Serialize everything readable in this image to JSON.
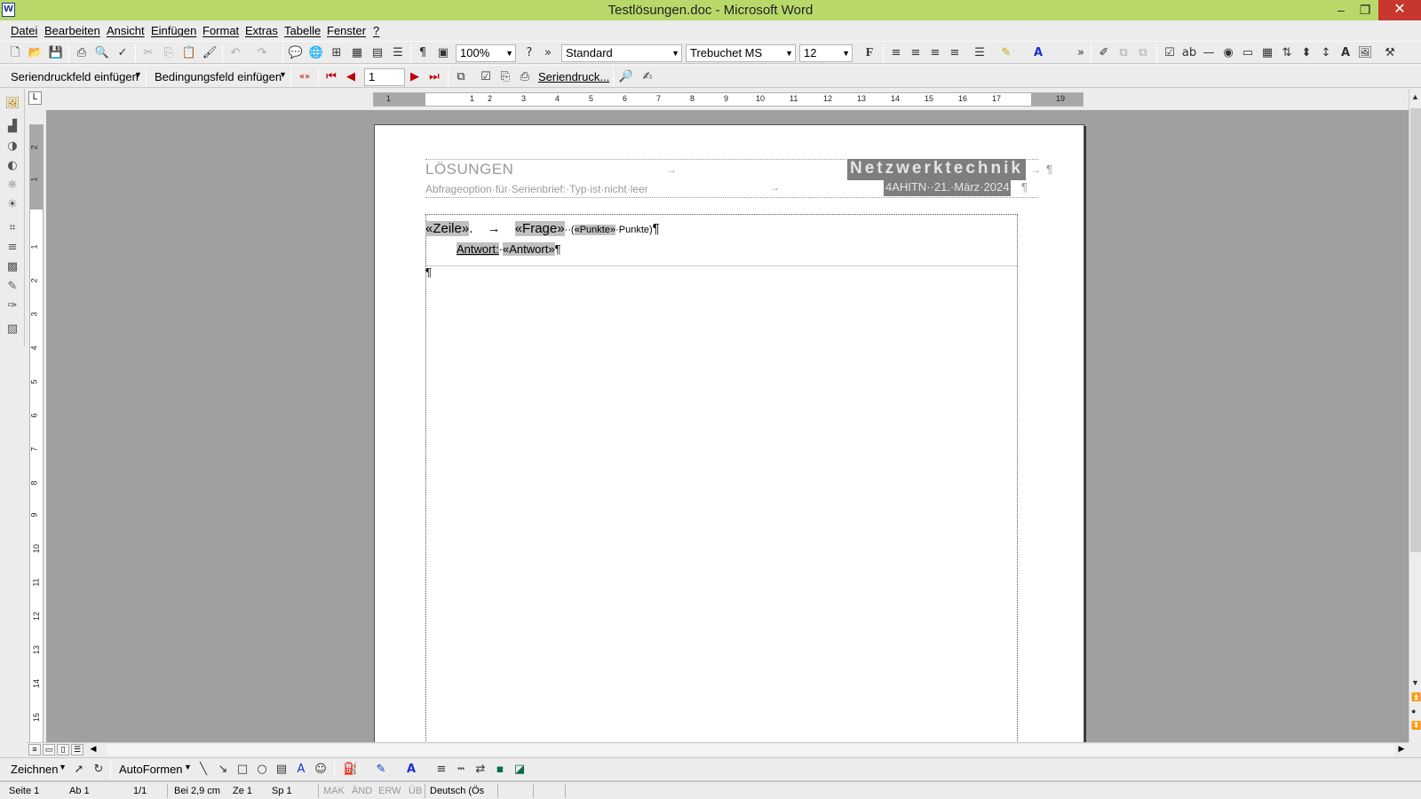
{
  "window": {
    "title": "Testlösungen.doc - Microsoft Word",
    "app_icon": "W"
  },
  "menu": [
    "Datei",
    "Bearbeiten",
    "Ansicht",
    "Einfügen",
    "Format",
    "Extras",
    "Tabelle",
    "Fenster",
    "?"
  ],
  "toolbar_standard": {
    "zoom": "100%",
    "style": "Standard",
    "font": "Trebuchet MS",
    "size": "12",
    "bold_label": "F"
  },
  "toolbar_mailmerge": {
    "insert_field": "Seriendruckfeld einfügen",
    "condition_field": "Bedingungsfeld einfügen",
    "record_number": "1",
    "merge_label": "Seriendruck..."
  },
  "ruler": {
    "h_ticks": [
      "1",
      "2",
      "1",
      "2",
      "3",
      "4",
      "5",
      "6",
      "7",
      "8",
      "9",
      "10",
      "11",
      "12",
      "13",
      "14",
      "15",
      "16",
      "17",
      "19"
    ],
    "v_ticks": [
      "2",
      "1",
      "1",
      "2",
      "3",
      "4",
      "5",
      "6",
      "7",
      "8",
      "9",
      "10",
      "11",
      "12",
      "13",
      "14",
      "15"
    ]
  },
  "document": {
    "header_left_title": "LÖSUNGEN",
    "header_left_sub": "Abfrageoption·für·Serienbrief:·Typ·ist·nicht·leer",
    "header_right_title": "Netzwerktechnik",
    "header_right_sub": "4AHITN··21.·März·2024",
    "field_zeile": "«Zeile»",
    "dot": ".",
    "tab_arrow": "→",
    "field_frage": "«Frage»",
    "paren_open": "··(",
    "field_punkte": "«Punkte»",
    "punkte_text": "·Punkte)",
    "pilcrow": "¶",
    "answer_label": "Antwort:",
    "answer_sep": "·",
    "field_antwort": "«Antwort»"
  },
  "drawing": {
    "draw_label": "Zeichnen",
    "autoshapes_label": "AutoFormen"
  },
  "status": {
    "page": "Seite 1",
    "section": "Ab 1",
    "pages": "1/1",
    "at": "Bei 2,9 cm",
    "line": "Ze 1",
    "col": "Sp 1",
    "mak": "MAK",
    "and": "ÄND",
    "erw": "ERW",
    "ub": "ÜB",
    "lang": "Deutsch (Ös"
  },
  "colors": {
    "titlebar": "#b8d96a",
    "close": "#c7372f",
    "field_shading": "#c0c0c0",
    "header_shading": "#7e7e7e"
  }
}
